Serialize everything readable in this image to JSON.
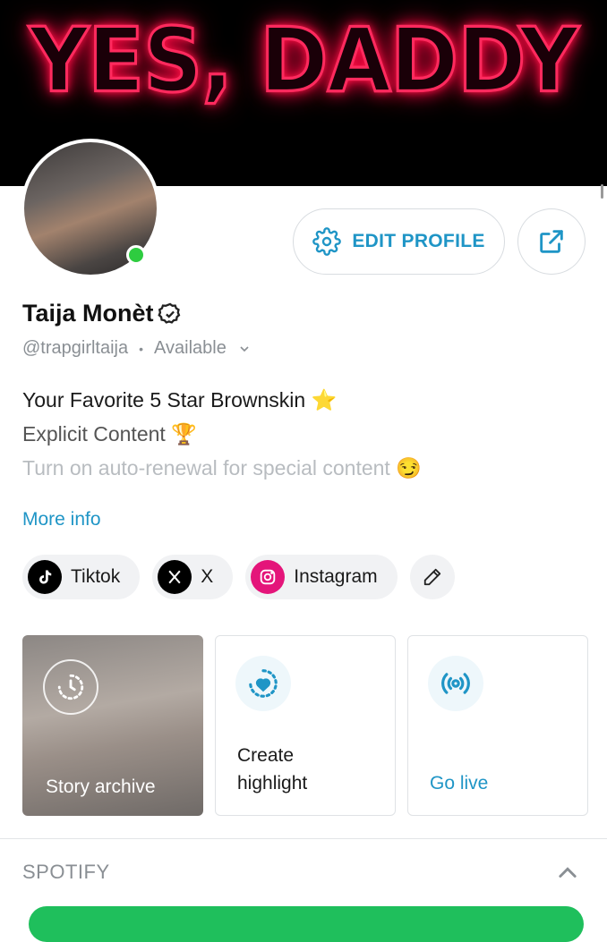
{
  "banner": {
    "text": "YES, DADDY"
  },
  "profile": {
    "name": "Taija Monèt",
    "handle": "@trapgirltaija",
    "status": "Available",
    "online_color": "#2ecc40"
  },
  "actions": {
    "edit_label": "EDIT PROFILE"
  },
  "bio": {
    "lines": [
      "Your Favorite 5 Star Brownskin ⭐",
      "Explicit Content 🏆",
      "Turn on auto-renewal for special content 😏"
    ],
    "more_label": "More info"
  },
  "socials": [
    {
      "label": "Tiktok",
      "icon": "tiktok-icon"
    },
    {
      "label": "X",
      "icon": "x-icon"
    },
    {
      "label": "Instagram",
      "icon": "instagram-icon"
    }
  ],
  "cards": {
    "archive_label": "Story archive",
    "highlight_line1": "Create",
    "highlight_line2": "highlight",
    "live_label": "Go live"
  },
  "spotify": {
    "title": "SPOTIFY",
    "accent": "#1fbf5c"
  },
  "colors": {
    "accent": "#1f95c6",
    "neon": "#ff2a5e"
  }
}
